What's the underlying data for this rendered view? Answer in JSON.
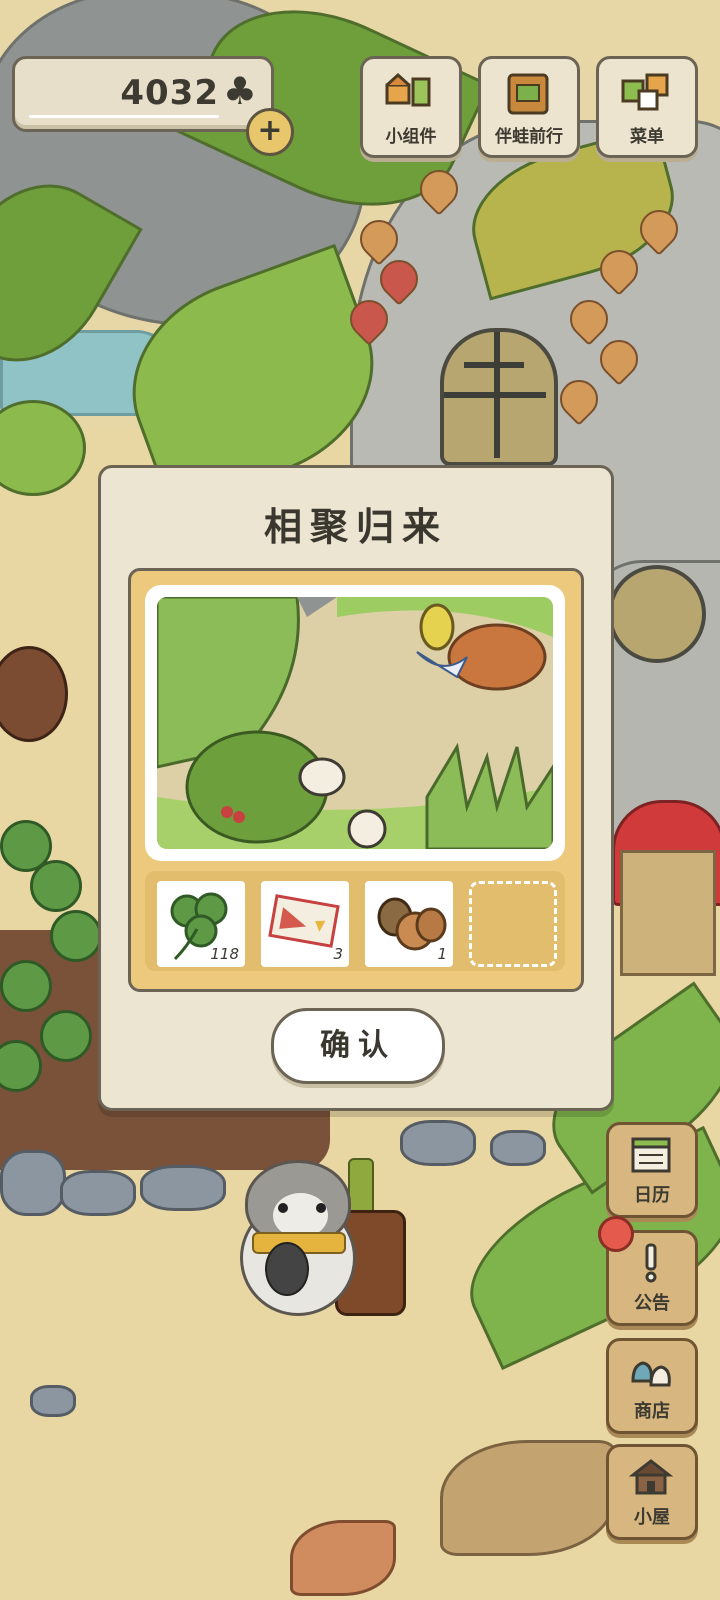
{
  "currency": {
    "amount": "4032",
    "icon": "clover-icon",
    "add_icon": "plus-icon"
  },
  "top_buttons": [
    {
      "label": "小组件",
      "icon": "widget-icon"
    },
    {
      "label": "伴蛙前行",
      "icon": "journey-book-icon"
    },
    {
      "label": "菜单",
      "icon": "menu-icon"
    }
  ],
  "side_buttons": [
    {
      "label": "日历",
      "icon": "calendar-icon"
    },
    {
      "label": "公告",
      "icon": "exclamation-icon"
    },
    {
      "label": "商店",
      "icon": "shop-bags-icon"
    },
    {
      "label": "小屋",
      "icon": "house-icon"
    }
  ],
  "dialog": {
    "title": "相聚归来",
    "items": [
      {
        "icon": "clover-icon",
        "count": "118"
      },
      {
        "icon": "ticket-icon",
        "count": "3"
      },
      {
        "icon": "acorn-nuts-icon",
        "count": "1"
      },
      {
        "icon": "empty-slot",
        "count": ""
      }
    ],
    "confirm_label": "确认"
  },
  "colors": {
    "panel": "#ece5d2",
    "frame": "#ecc97d",
    "outline": "#6b6454",
    "wood": "#d7b77f",
    "notification": "#e45b4d"
  }
}
